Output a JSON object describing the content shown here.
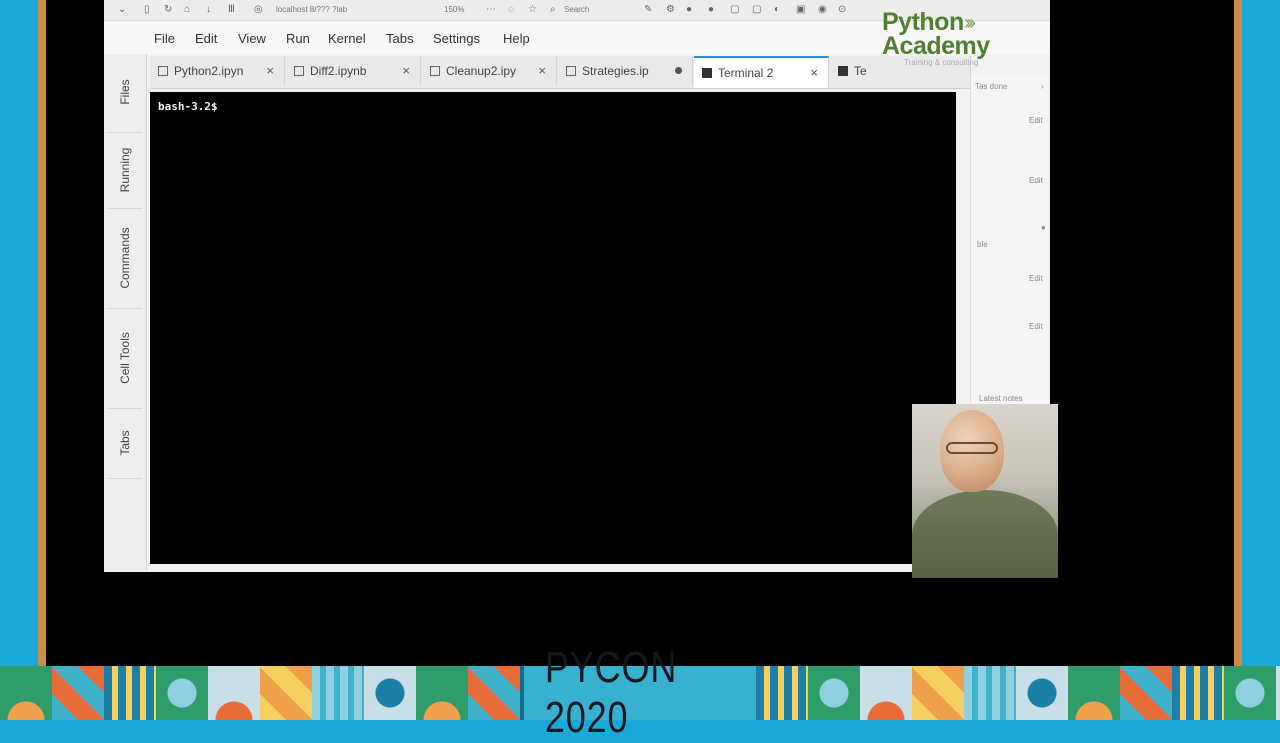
{
  "browser": {
    "url": "localhost 8/??? ?lab",
    "zoom": "150%",
    "search_placeholder": "Search"
  },
  "menu": [
    "File",
    "Edit",
    "View",
    "Run",
    "Kernel",
    "Tabs",
    "Settings",
    "Help"
  ],
  "tabs": [
    {
      "label": "Python2.ipyn",
      "type": "notebook",
      "close": "×"
    },
    {
      "label": "Diff2.ipynb",
      "type": "notebook",
      "close": "×"
    },
    {
      "label": "Cleanup2.ipy",
      "type": "notebook",
      "close": "×"
    },
    {
      "label": "Strategies.ip",
      "type": "notebook",
      "modified": true
    },
    {
      "label": "Terminal 2",
      "type": "terminal",
      "active": true,
      "close": "×"
    },
    {
      "label": "Te",
      "type": "terminal"
    }
  ],
  "left_sidebar": [
    "Files",
    "Running",
    "Commands",
    "Cell Tools",
    "Tabs"
  ],
  "terminal": {
    "prompt": "bash-3.2$"
  },
  "right_panel": {
    "header": "Tas done",
    "edit_label": "Edit",
    "other_label": "ble",
    "section": "Latest notes"
  },
  "logo": {
    "line1": "Python",
    "line2": "Academy",
    "tagline": "Training & consulting"
  },
  "banner": {
    "title": "PYCON 2020"
  },
  "colors": {
    "background": "#1aa9d6",
    "frame_accent": "#c98d48",
    "banner": "#0f6a8f",
    "logo_green": "#4f7f2f",
    "active_tab": "#2a8fd6"
  }
}
